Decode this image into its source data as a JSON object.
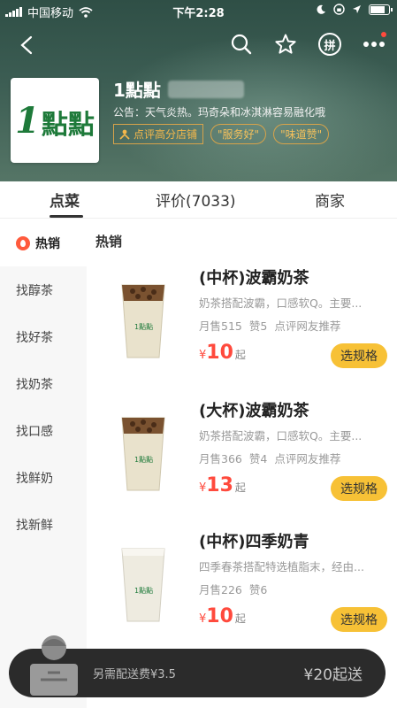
{
  "status_bar": {
    "carrier": "中国移动",
    "time": "下午2:28"
  },
  "header": {
    "pin_label": "拼",
    "logo_text": "點點",
    "store_name": "1點點",
    "notice": "公告：天气炎热。玛奇朵和冰淇淋容易融化哦",
    "badge_high": "点评高分店铺",
    "badge_service": "\"服务好\"",
    "badge_taste": "\"味道赞\""
  },
  "tabs": {
    "order": "点菜",
    "reviews": "评价(7033)",
    "merchant": "商家"
  },
  "sidebar": {
    "items": [
      "热销",
      "找醇茶",
      "找好茶",
      "找奶茶",
      "找口感",
      "找鲜奶",
      "找新鲜"
    ]
  },
  "section_title": "热销",
  "products": [
    {
      "name": "(中杯)波霸奶茶",
      "desc": "奶茶搭配波霸，口感软Q。主要...",
      "sales": "月售515",
      "likes": "赞5",
      "extra": "点评网友推荐",
      "currency": "¥",
      "price": "10",
      "suffix": "起",
      "button": "选规格"
    },
    {
      "name": "(大杯)波霸奶茶",
      "desc": "奶茶搭配波霸，口感软Q。主要...",
      "sales": "月售366",
      "likes": "赞4",
      "extra": "点评网友推荐",
      "currency": "¥",
      "price": "13",
      "suffix": "起",
      "button": "选规格"
    },
    {
      "name": "(中杯)四季奶青",
      "desc": "四季春茶搭配特选植脂末，经由...",
      "sales": "月售226",
      "likes": "赞6",
      "extra": "",
      "currency": "¥",
      "price": "10",
      "suffix": "起",
      "button": "选规格"
    }
  ],
  "cart": {
    "extra_fee": "另需配送费¥3.5",
    "min_order": "¥20起送"
  },
  "colors": {
    "accent": "#f7c136",
    "price": "#ff4a3d",
    "brand_green": "#1e7a3a",
    "header_bg": "#3c5d53"
  }
}
